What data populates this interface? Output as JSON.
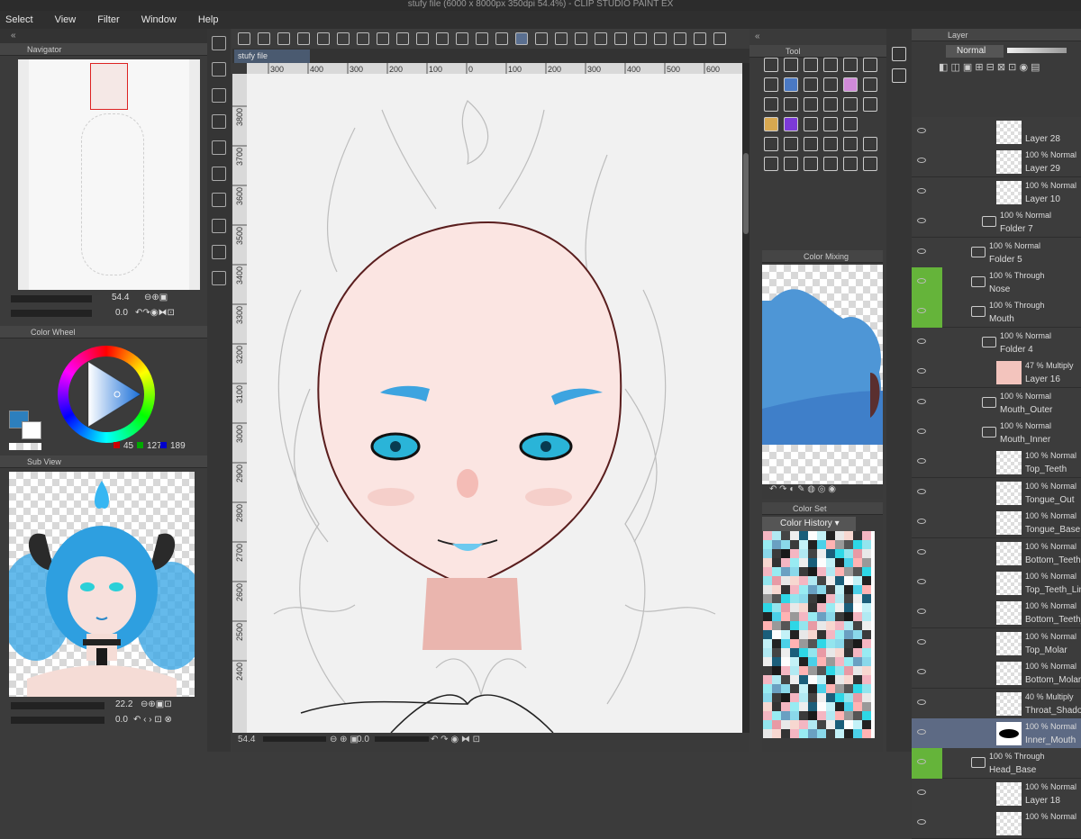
{
  "window": {
    "title": "stufy file (6000 x 8000px 350dpi 54.4%)  - CLIP STUDIO PAINT EX"
  },
  "menu": [
    "Select",
    "View",
    "Filter",
    "Window",
    "Help"
  ],
  "document_tab": "stufy file",
  "navigator": {
    "title": "Navigator",
    "zoom": "54.4",
    "rotation": "0.0"
  },
  "color_wheel": {
    "title": "Color Wheel",
    "r": "45",
    "g": "127",
    "b": "189",
    "main_color": "#2d7fbd",
    "sub_color": "#ffffff"
  },
  "sub_view": {
    "title": "Sub View",
    "zoom": "22.2",
    "rotation": "0.0"
  },
  "tool_panel": {
    "title": "Tool"
  },
  "color_mixing": {
    "title": "Color Mixing"
  },
  "color_set": {
    "title": "Color Set",
    "dropdown": "Color History"
  },
  "layer_panel": {
    "title": "Layer",
    "blend_mode": "Normal"
  },
  "ruler_h": [
    "300",
    "400",
    "300",
    "200",
    "100",
    "0",
    "100",
    "200",
    "300",
    "400",
    "500",
    "600"
  ],
  "ruler_v": [
    "3800",
    "3700",
    "3600",
    "3500",
    "3400",
    "3300",
    "3200",
    "3100",
    "3000",
    "2900",
    "2800",
    "2700",
    "2600",
    "2500",
    "2400"
  ],
  "status": {
    "zoom": "54.4",
    "rotation": "0.0"
  },
  "layers": [
    {
      "opacity": "",
      "name": "Layer 28",
      "folder": false,
      "green": false,
      "indent": 0
    },
    {
      "opacity": "100 % Normal",
      "name": "Layer 29",
      "folder": false,
      "green": false,
      "indent": 0
    },
    {
      "opacity": "100 % Normal",
      "name": "Layer 10",
      "folder": false,
      "green": false,
      "indent": 0
    },
    {
      "opacity": "100 % Normal",
      "name": "Folder 7",
      "folder": true,
      "green": false,
      "indent": 1
    },
    {
      "opacity": "100 % Normal",
      "name": "Folder 5",
      "folder": true,
      "green": false,
      "indent": 0
    },
    {
      "opacity": "100 % Through",
      "name": "Nose",
      "folder": true,
      "green": true,
      "indent": 0
    },
    {
      "opacity": "100 % Through",
      "name": "Mouth",
      "folder": true,
      "green": true,
      "indent": 0
    },
    {
      "opacity": "100 % Normal",
      "name": "Folder 4",
      "folder": true,
      "green": false,
      "indent": 1
    },
    {
      "opacity": "47 % Multiply",
      "name": "Layer 16",
      "folder": false,
      "green": false,
      "indent": 0
    },
    {
      "opacity": "100 % Normal",
      "name": "Mouth_Outer",
      "folder": true,
      "green": false,
      "indent": 1
    },
    {
      "opacity": "100 % Normal",
      "name": "Mouth_Inner",
      "folder": true,
      "green": false,
      "indent": 1
    },
    {
      "opacity": "100 % Normal",
      "name": "Top_Teeth",
      "folder": false,
      "green": false,
      "indent": 0
    },
    {
      "opacity": "100 % Normal",
      "name": "Tongue_Out",
      "folder": false,
      "green": false,
      "indent": 0
    },
    {
      "opacity": "100 % Normal",
      "name": "Tongue_Base",
      "folder": false,
      "green": false,
      "indent": 0
    },
    {
      "opacity": "100 % Normal",
      "name": "Bottom_Teeth",
      "folder": false,
      "green": false,
      "indent": 0
    },
    {
      "opacity": "100 % Normal",
      "name": "Top_Teeth_Line",
      "folder": false,
      "green": false,
      "indent": 0
    },
    {
      "opacity": "100 % Normal",
      "name": "Bottom_Teeth_Line",
      "folder": false,
      "green": false,
      "indent": 0
    },
    {
      "opacity": "100 % Normal",
      "name": "Top_Molar",
      "folder": false,
      "green": false,
      "indent": 0
    },
    {
      "opacity": "100 % Normal",
      "name": "Bottom_Molar",
      "folder": false,
      "green": false,
      "indent": 0
    },
    {
      "opacity": "40 % Multiply",
      "name": "Throat_Shadow",
      "folder": false,
      "green": false,
      "indent": 0
    },
    {
      "opacity": "100 % Normal",
      "name": "Inner_Mouth",
      "folder": false,
      "green": false,
      "indent": 0,
      "selected": true
    },
    {
      "opacity": "100 % Through",
      "name": "Head_Base",
      "folder": true,
      "green": true,
      "indent": 0
    },
    {
      "opacity": "100 % Normal",
      "name": "Layer 18",
      "folder": false,
      "green": false,
      "indent": 0
    },
    {
      "opacity": "100 % Normal",
      "name": "",
      "folder": false,
      "green": false,
      "indent": 0
    }
  ]
}
